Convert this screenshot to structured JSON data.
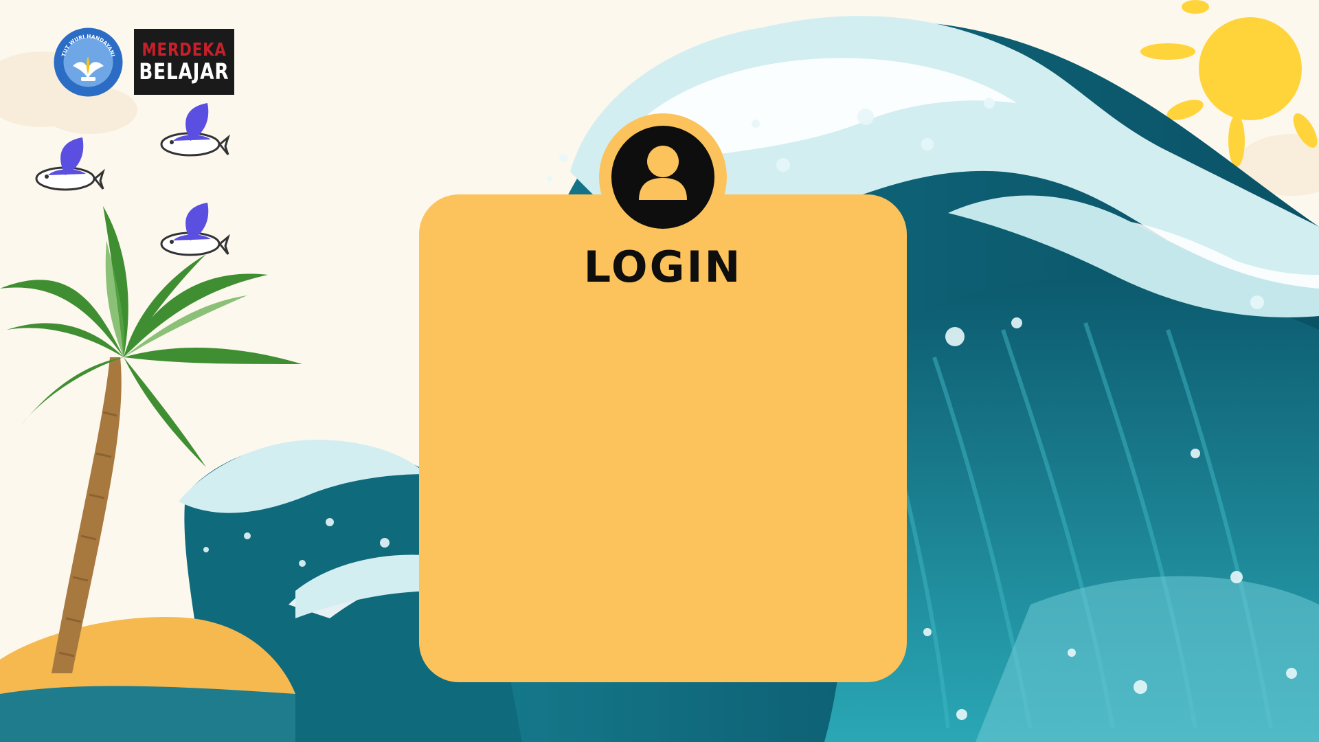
{
  "brand": {
    "kemdikbud_motto": "TUT WURI HANDAYANI",
    "merdeka_line1": "MERDEKA",
    "merdeka_line2": "BELAJAR"
  },
  "login": {
    "title": "LOGIN",
    "avatar_icon": "user-icon"
  },
  "decor": {
    "icons": [
      "bird-icon",
      "palm-tree-icon",
      "sun-icon",
      "wave-illustration",
      "island-icon"
    ]
  },
  "colors": {
    "background": "#fdf8ee",
    "card": "#fcc35c",
    "avatar": "#0e0e0e",
    "wave_dark": "#0d5f70",
    "wave_mid": "#1e8fa0",
    "foam": "#bfe6ea",
    "sand": "#f6b94f",
    "sun": "#ffd43b",
    "bird": "#5a4fe0"
  }
}
